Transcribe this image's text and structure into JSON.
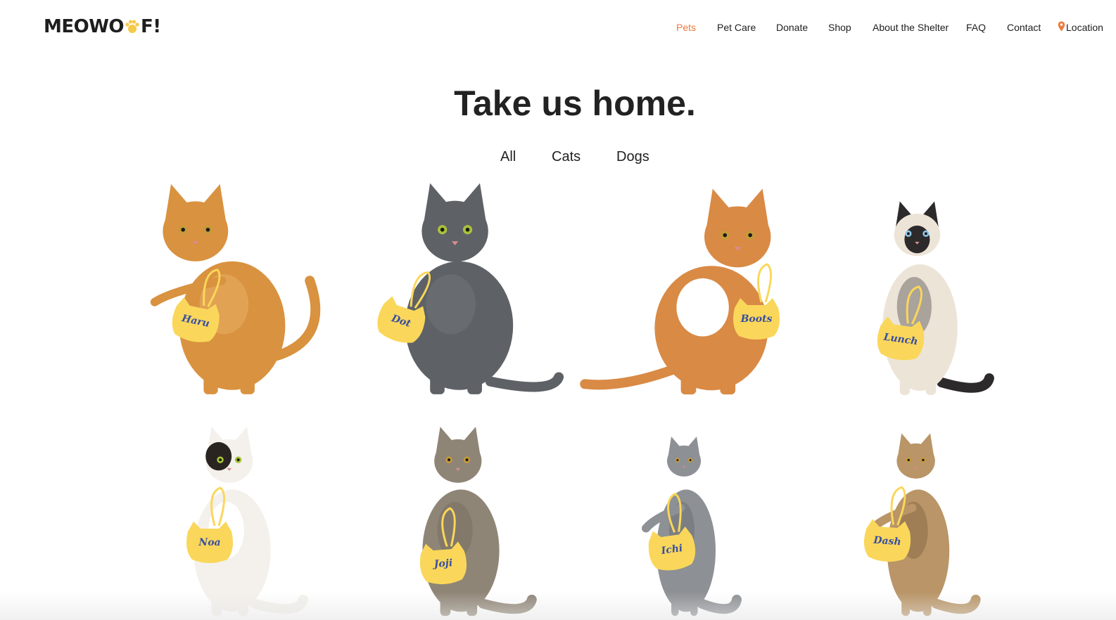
{
  "brand": {
    "logo_left": "MEOWO",
    "logo_right": "F!"
  },
  "nav": {
    "items": [
      "Pets",
      "Pet Care",
      "Donate",
      "Shop",
      "About the Shelter",
      "FAQ",
      "Contact",
      "Location"
    ],
    "active": "Pets",
    "location_icon": "map-pin-icon"
  },
  "hero": {
    "title": "Take us home."
  },
  "filters": [
    "All",
    "Cats",
    "Dogs"
  ],
  "pets": [
    {
      "name": "Haru",
      "coat": "orange tabby",
      "body": "#d9923f",
      "accent": "#f1c07a"
    },
    {
      "name": "Dot",
      "coat": "gray",
      "body": "#5e6266",
      "accent": "#7c8186"
    },
    {
      "name": "Boots",
      "coat": "orange & white",
      "body": "#d98a45",
      "accent": "#ffffff"
    },
    {
      "name": "Lunch",
      "coat": "siamese",
      "body": "#ede4d8",
      "accent": "#2c2a2a"
    },
    {
      "name": "Noa",
      "coat": "calico",
      "body": "#f4f1ec",
      "accent": "#2a2420"
    },
    {
      "name": "Joji",
      "coat": "brown tabby",
      "body": "#8f8576",
      "accent": "#6c6355"
    },
    {
      "name": "Ichi",
      "coat": "gray tabby",
      "body": "#8d9094",
      "accent": "#5d6064"
    },
    {
      "name": "Dash",
      "coat": "bengal",
      "body": "#b99567",
      "accent": "#6f5434"
    }
  ],
  "colors": {
    "accent": "#f07a3a",
    "tag": "#fad75a",
    "tag_text": "#3a4fa0",
    "text": "#222222"
  }
}
